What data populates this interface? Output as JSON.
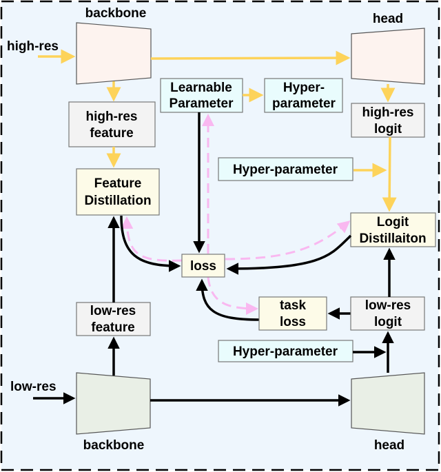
{
  "colors": {
    "background": "#eef6fd",
    "high_res_flow": "#fdd35a",
    "low_res_flow": "#000000",
    "gradient_flow": "#f9b8f0"
  },
  "top": {
    "input": "high-res",
    "backbone": "backbone",
    "head": "head",
    "feature": [
      "high-res",
      "feature"
    ],
    "logit": [
      "high-res",
      "logit"
    ]
  },
  "bottom": {
    "input": "low-res",
    "backbone": "backbone",
    "head": "head",
    "feature": [
      "low-res",
      "feature"
    ],
    "logit": [
      "low-res",
      "logit"
    ]
  },
  "learnable": [
    "Learnable",
    "Parameter"
  ],
  "hyper_top": [
    "Hyper-",
    "parameter"
  ],
  "hyper_mid": "Hyper-parameter",
  "hyper_bottom": "Hyper-parameter",
  "feature_distillation": [
    "Feature",
    "Distillation"
  ],
  "logit_distillation": [
    "Logit",
    "Distillaiton"
  ],
  "loss": "loss",
  "task_loss": [
    "task",
    "loss"
  ]
}
